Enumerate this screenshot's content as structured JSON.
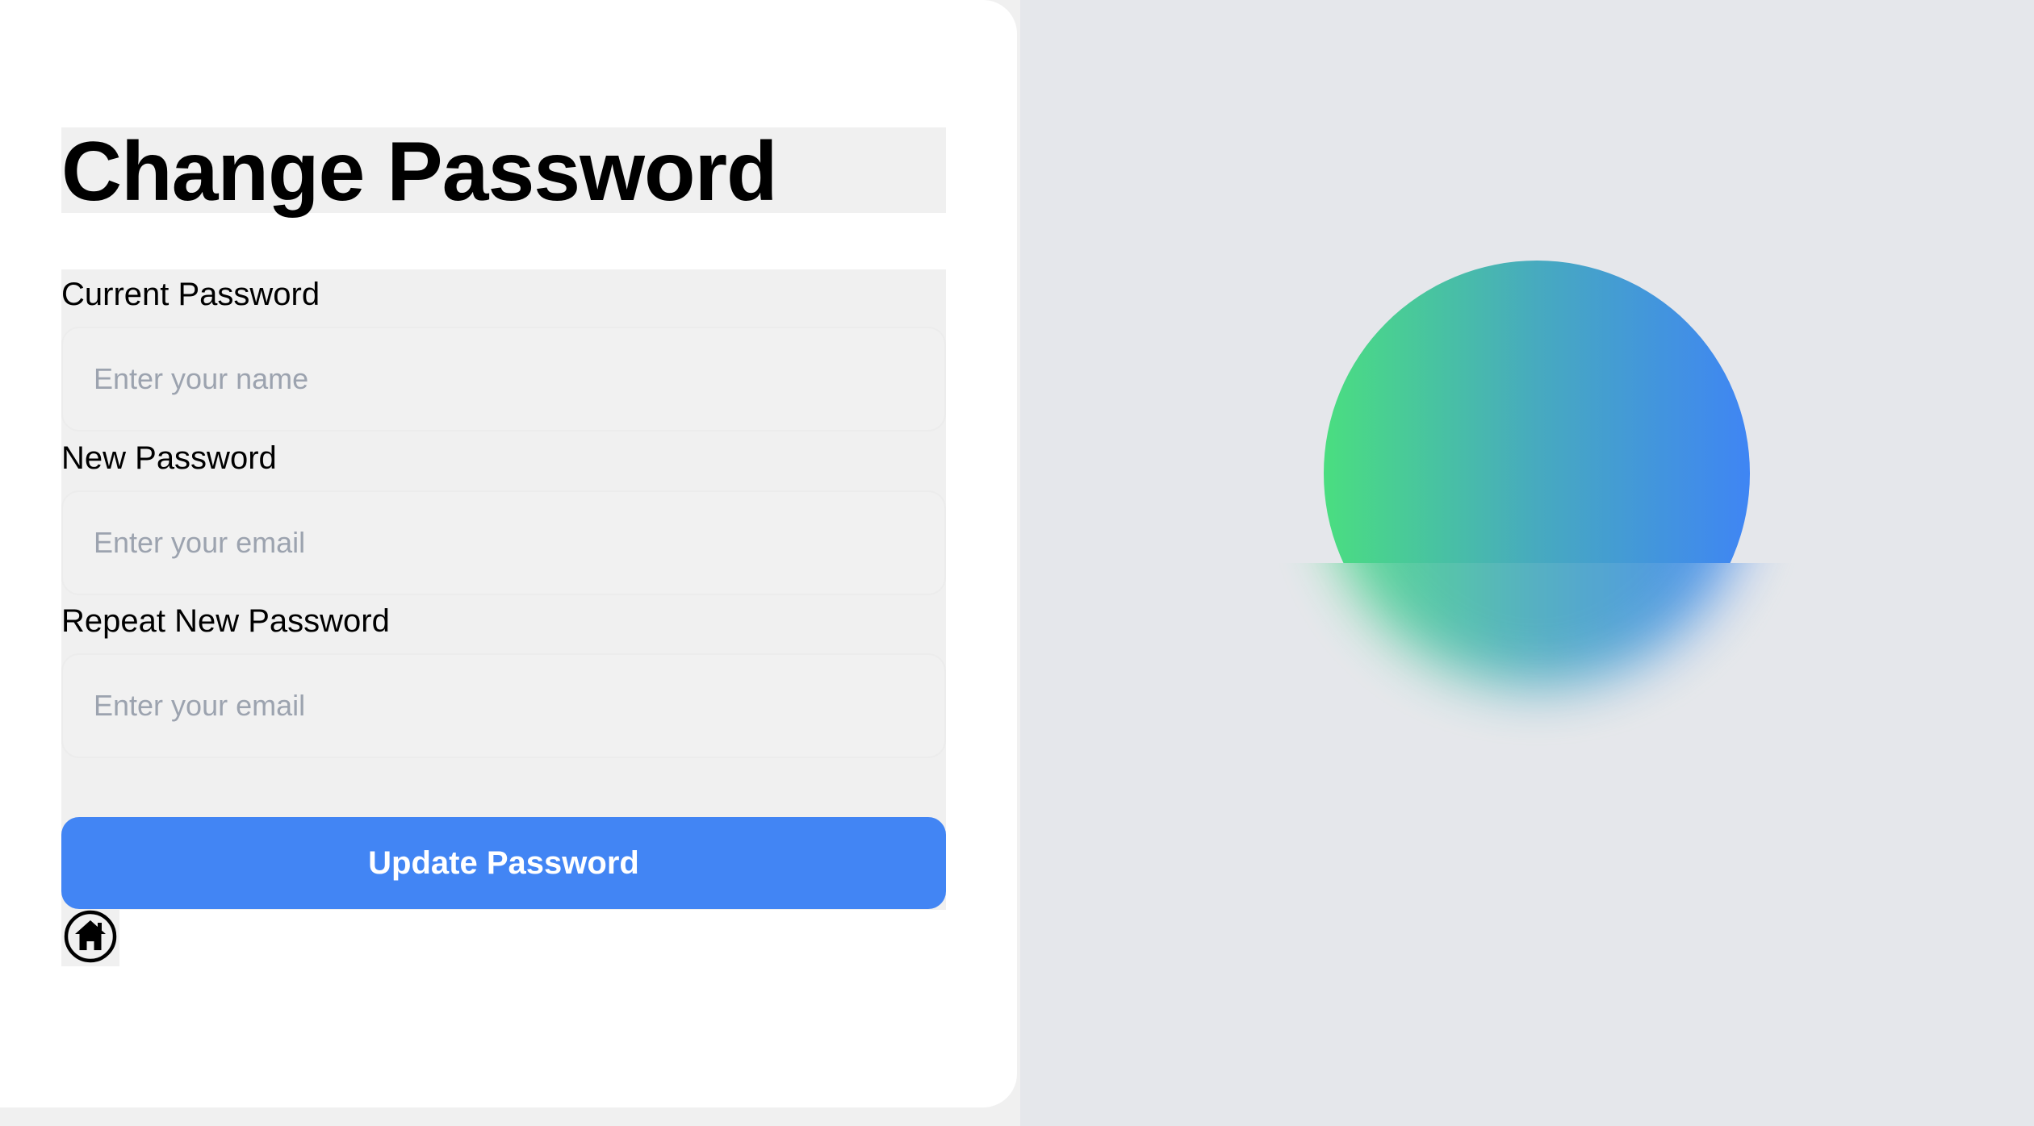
{
  "page": {
    "title": "Change Password"
  },
  "form": {
    "current_password": {
      "label": "Current Password",
      "placeholder": "Enter your name",
      "value": ""
    },
    "new_password": {
      "label": "New Password",
      "placeholder": "Enter your email",
      "value": ""
    },
    "repeat_password": {
      "label": "Repeat New Password",
      "placeholder": "Enter your email",
      "value": ""
    },
    "submit_label": "Update Password"
  },
  "icons": {
    "home": "home-icon"
  },
  "colors": {
    "accent": "#4285f4",
    "gradient_start": "#4ade80",
    "gradient_end": "#3f85f4",
    "panel_background": "#e5e7eb"
  }
}
